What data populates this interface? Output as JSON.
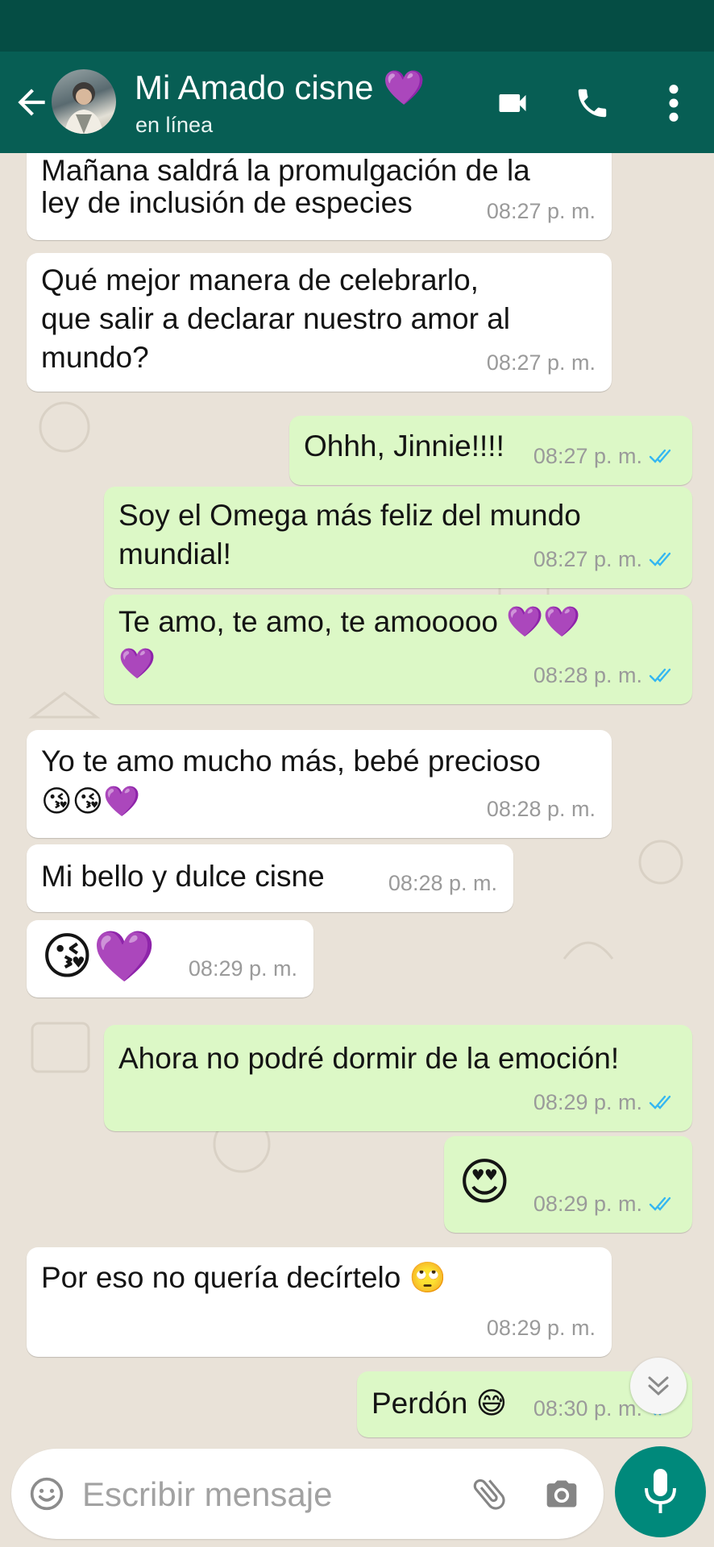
{
  "header": {
    "contact_name": "Mi Amado cisne 💜",
    "status": "en línea"
  },
  "icons": {
    "back": "arrow-left-icon",
    "video": "video-camera-icon",
    "call": "phone-icon",
    "menu": "more-vertical-icon",
    "emoji": "emoji-smiley-icon",
    "attach": "paperclip-icon",
    "camera": "camera-icon",
    "mic": "microphone-icon",
    "scroll": "chevron-double-down-icon"
  },
  "colors": {
    "header": "#075e54",
    "statusbar": "#054d44",
    "outgoing": "#dcf8c6",
    "incoming": "#ffffff",
    "read_ticks": "#34b7f1",
    "mic_button": "#00897b"
  },
  "messages": [
    {
      "direction": "in",
      "text": "Mañana saldrá la promulgación de la\nley de inclusión de especies",
      "time": "08:27 p. m."
    },
    {
      "direction": "in",
      "text": "Qué mejor manera de celebrarlo,\nque salir a declarar nuestro amor al\nmundo?",
      "time": "08:27 p. m."
    },
    {
      "direction": "out",
      "text": "Ohhh, Jinnie!!!!",
      "time": "08:27 p. m.",
      "read": true
    },
    {
      "direction": "out",
      "text": "Soy el Omega más feliz del mundo\nmundial!",
      "time": "08:27 p. m.",
      "read": true
    },
    {
      "direction": "out",
      "text": "Te amo, te amo, te amooooo 💜💜\n💜",
      "time": "08:28 p. m.",
      "read": true
    },
    {
      "direction": "in",
      "text": "Yo te amo mucho más, bebé precioso\n😘😘💜",
      "time": "08:28 p. m."
    },
    {
      "direction": "in",
      "text": "Mi bello y dulce cisne",
      "time": "08:28 p. m."
    },
    {
      "direction": "in",
      "text": "😘💜",
      "time": "08:29 p. m."
    },
    {
      "direction": "out",
      "text": "Ahora no podré dormir de la emoción!",
      "time": "08:29 p. m.",
      "read": true
    },
    {
      "direction": "out",
      "text": "😍",
      "time": "08:29 p. m.",
      "read": true
    },
    {
      "direction": "in",
      "text": "Por eso no quería decírtelo 🙄",
      "time": "08:29 p. m."
    },
    {
      "direction": "out",
      "text": "Perdón 😅",
      "time": "08:30 p. m.",
      "read": true
    }
  ],
  "input": {
    "placeholder": "Escribir mensaje"
  }
}
